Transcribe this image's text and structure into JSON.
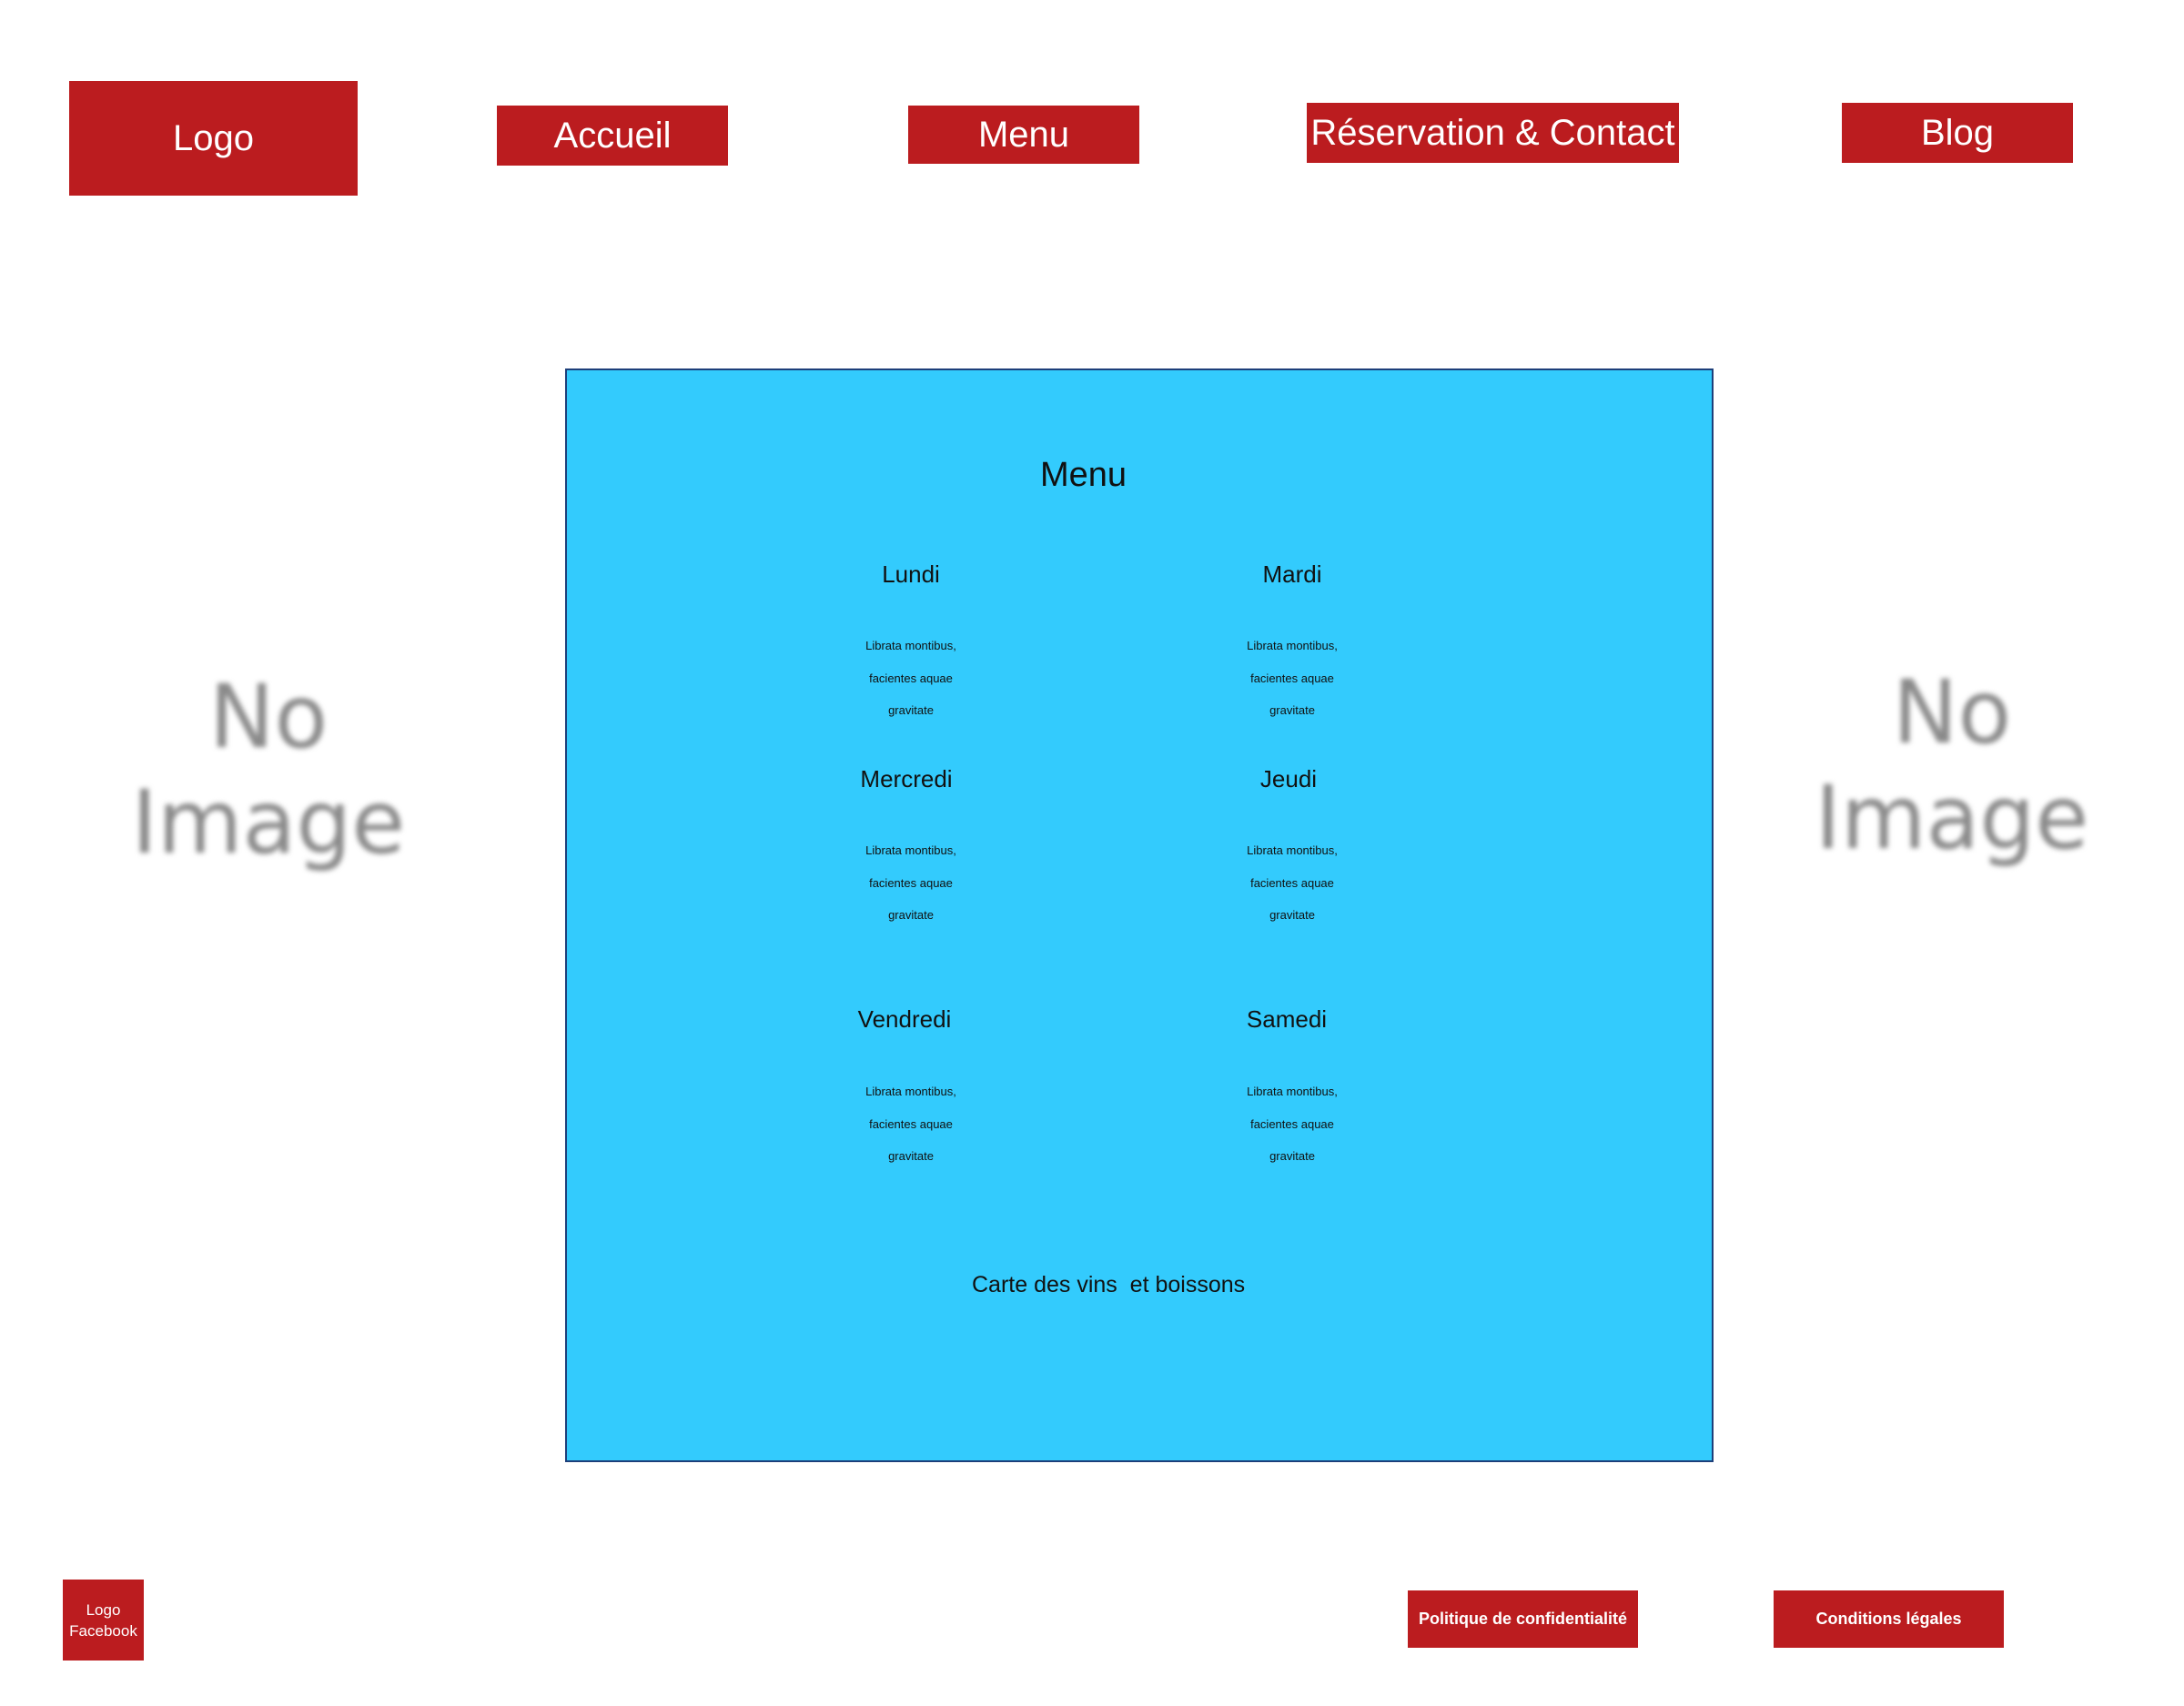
{
  "header": {
    "logo_label": "Logo",
    "nav": [
      "Accueil",
      "Menu",
      "Réservation & Contact",
      "Blog"
    ]
  },
  "placeholders": {
    "left": [
      "No",
      "Image"
    ],
    "right": [
      "No",
      "Image"
    ]
  },
  "menu": {
    "title": "Menu",
    "days": [
      {
        "name": "Lundi",
        "lines": [
          "Librata montibus,",
          "facientes aquae",
          "gravitate"
        ]
      },
      {
        "name": "Mardi",
        "lines": [
          "Librata montibus,",
          "facientes aquae",
          "gravitate"
        ]
      },
      {
        "name": "Mercredi",
        "lines": [
          "Librata montibus,",
          "facientes aquae",
          "gravitate"
        ]
      },
      {
        "name": "Jeudi",
        "lines": [
          "Librata montibus,",
          "facientes aquae",
          "gravitate"
        ]
      },
      {
        "name": "Vendredi",
        "lines": [
          "Librata montibus,",
          "facientes aquae",
          "gravitate"
        ]
      },
      {
        "name": "Samedi",
        "lines": [
          "Librata montibus,",
          "facientes aquae",
          "gravitate"
        ]
      }
    ],
    "wine_link": "Carte des vins  et boissons"
  },
  "footer": {
    "facebook_logo": [
      "Logo",
      "Facebook"
    ],
    "privacy": "Politique de confidentialité",
    "terms": "Conditions légales"
  },
  "colors": {
    "brand_red": "#bb1c1f",
    "panel_blue": "#33cbfd",
    "panel_border": "#1d3f7a",
    "placeholder_gray": "#8a8a8a"
  }
}
